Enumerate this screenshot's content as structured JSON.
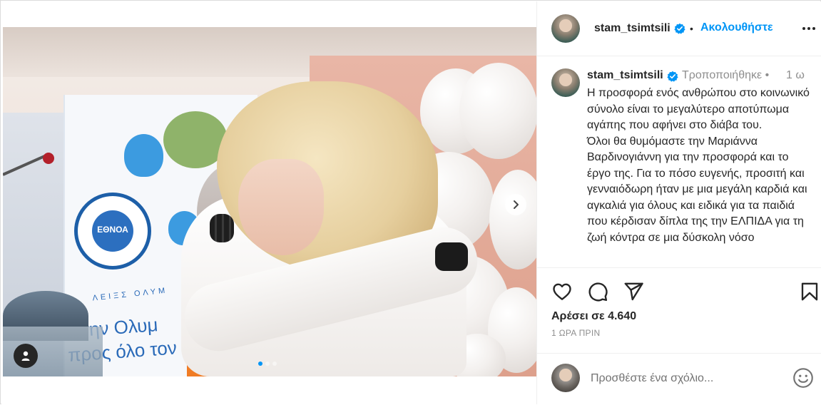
{
  "post": {
    "username": "stam_tsimtsili",
    "follow_label": "Ακολουθήστε",
    "separator": "•",
    "caption_edited": "Τροποποιήθηκε •",
    "caption_time": "1 ω",
    "caption": "Η προσφορά ενός ανθρώπου στο κοινωνικό σύνολο είναι το μεγαλύτερο αποτύπωμα αγάπης που αφήνει στο διάβα του.\nΌλοι θα θυμόμαστε την Μαριάννα Βαρδινογιάννη για την προσφορά και το έργο της. Για το πόσο ευγενής, προσιτή και γενναιόδωρη ήταν με μια μεγάλη καρδιά και αγκαλιά για όλους και ειδικά για τα παιδιά που κέρδισαν δίπλα της την ΕΛΠΙΔΑ για τη ζωή κόντρα σε μια δύσκολη νόσο",
    "likes": "Αρέσει σε 4.640",
    "posted_ago": "1 ΩΡΑ ΠΡΙΝ",
    "comment_placeholder": "Προσθέστε ένα σχόλιο..."
  },
  "carousel": {
    "slide_count": 3,
    "active_index": 0
  },
  "photo_text": {
    "logo_text": "ΕΘΝΟΑ",
    "banner_line": "ό την Ολυμ\nπρος όλο τον",
    "banner_small": "ΛΕΙΞΣ ΟΛΥΜ"
  },
  "colors": {
    "accent": "#0095f6",
    "verified": "#0095f6",
    "text": "#262626",
    "muted": "#8e8e8e"
  },
  "icons": {
    "verified": "verified-badge-icon",
    "more": "more-options-icon",
    "like": "heart-icon",
    "comment": "comment-icon",
    "share": "share-icon",
    "save": "bookmark-icon",
    "emoji": "emoji-icon",
    "next": "chevron-right-icon",
    "user_tag": "user-icon"
  }
}
